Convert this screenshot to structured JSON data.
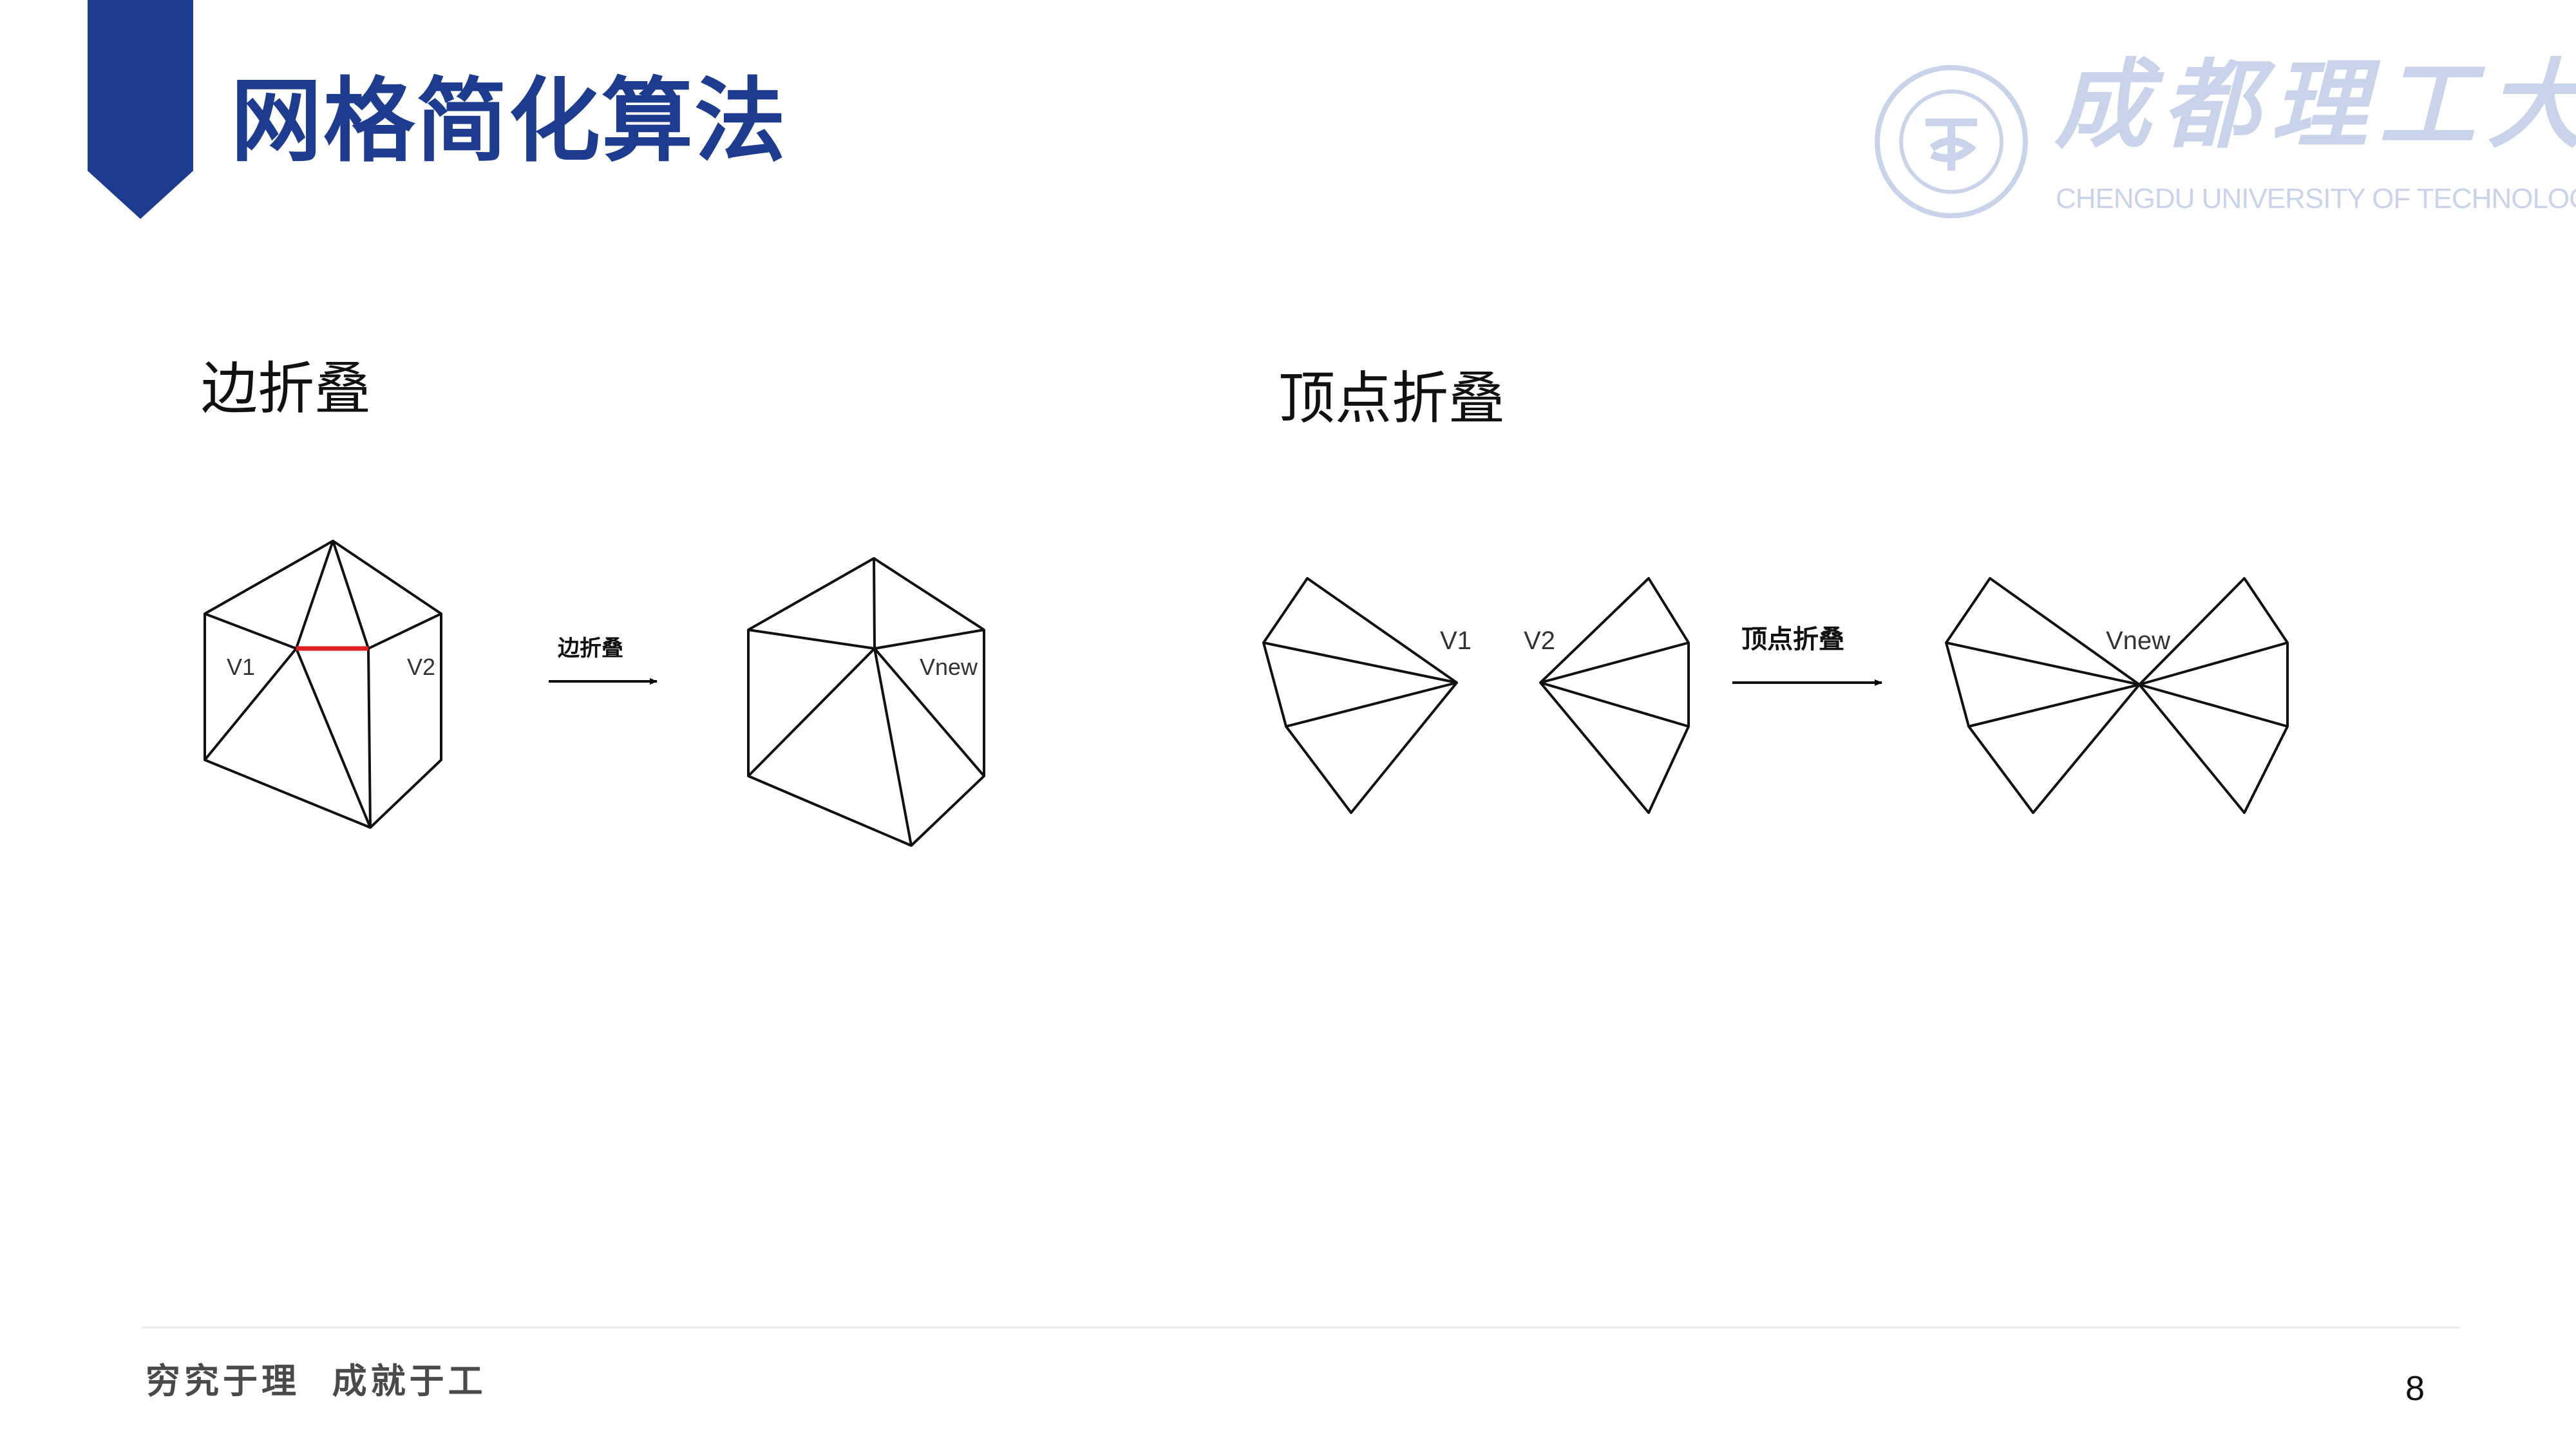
{
  "header": {
    "title": "网格简化算法",
    "logo_name": "成都理工大学",
    "logo_english": "CHENGDU UNIVERSITY OF TECHNOLOGY",
    "accent_color": "#1e3c8f",
    "logo_color": "#c9d4ea"
  },
  "edge_collapse": {
    "section_label": "边折叠",
    "arrow_label": "边折叠",
    "left_vertex": "V1",
    "right_vertex": "V2",
    "result_vertex": "Vnew",
    "collapsed_edge_color": "#e02020"
  },
  "vertex_collapse": {
    "section_label": "顶点折叠",
    "arrow_label": "顶点折叠",
    "left_vertex": "V1",
    "right_vertex": "V2",
    "result_vertex": "Vnew"
  },
  "footer": {
    "motto": "穷究于理  成就于工",
    "page_number": "8"
  }
}
